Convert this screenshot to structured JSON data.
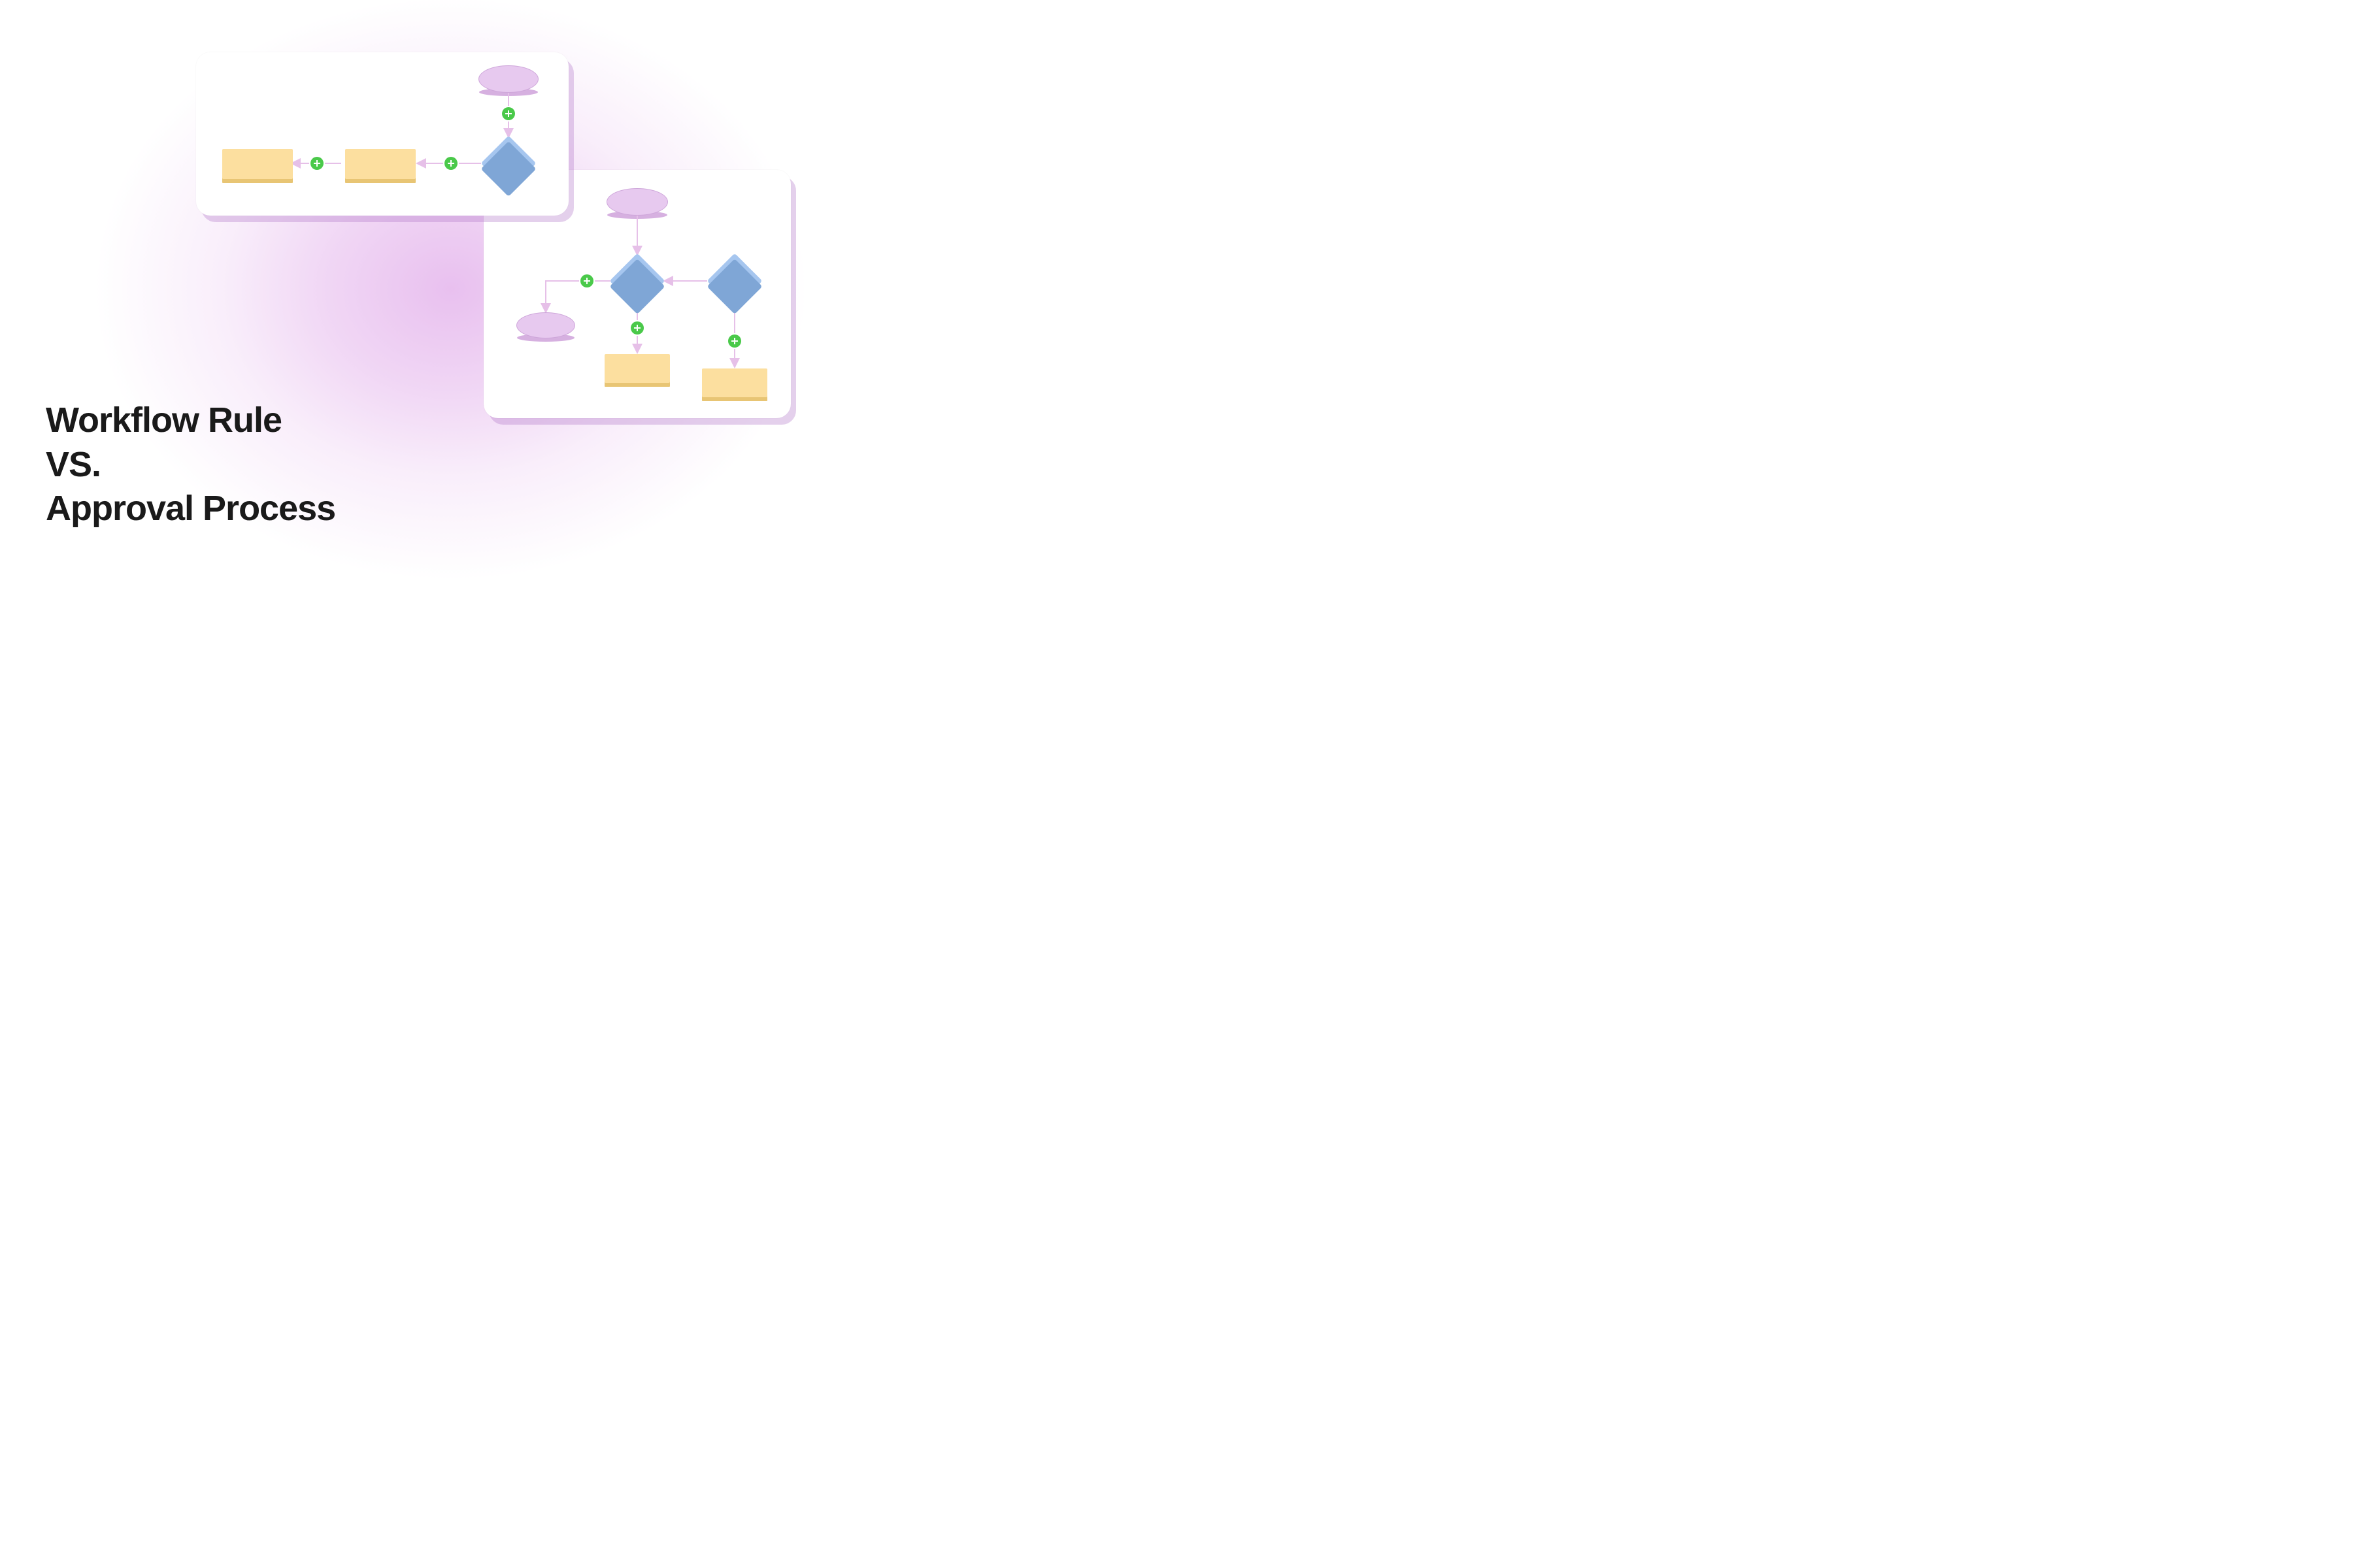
{
  "title": {
    "line1": "Workflow Rule",
    "line2": "VS.",
    "line3": "Approval Process"
  },
  "colors": {
    "glow": "#d68ce2",
    "ellipse_fill": "#e7c9ef",
    "diamond_fill": "#a6c6ef",
    "rect_fill": "#fcdf9f",
    "plus_fill": "#4ac94a",
    "connector": "#e6c0e8"
  },
  "cards": {
    "workflow_rule": {
      "description": "Linear flowchart: start ellipse → decision diamond → two process blocks in a row",
      "shapes": [
        "ellipse-start",
        "diamond-decision",
        "rect-step-1",
        "rect-step-2"
      ],
      "connectors_with_plus": 3
    },
    "approval_process": {
      "description": "Branching flowchart: start ellipse → decision diamond branches to ellipse and process blocks, second diamond also branches to process block",
      "shapes": [
        "ellipse-start",
        "diamond-decision-1",
        "diamond-decision-2",
        "ellipse-end",
        "rect-step-1",
        "rect-step-2"
      ],
      "connectors_with_plus": 3
    }
  }
}
